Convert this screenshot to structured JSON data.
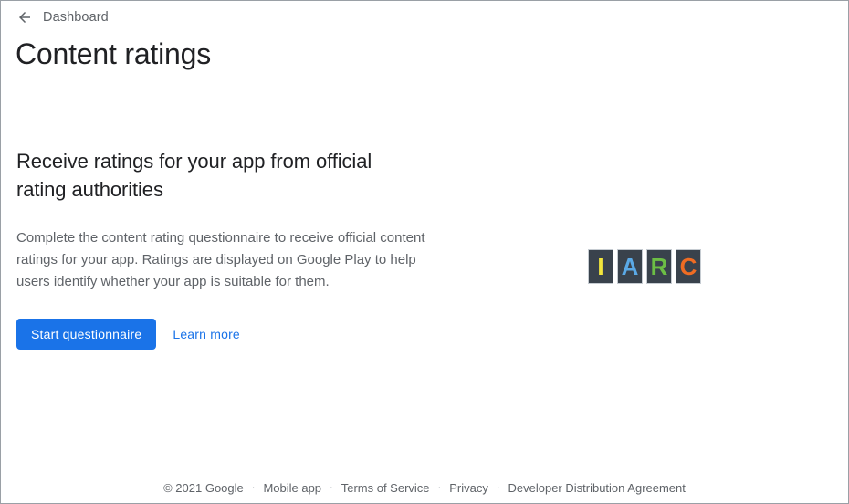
{
  "back_nav": {
    "icon": "arrow-left-icon",
    "label": "Dashboard"
  },
  "page_title": "Content ratings",
  "promo": {
    "heading": "Receive ratings for your app from official rating authorities",
    "body": "Complete the content rating questionnaire to receive official content ratings for your app. Ratings are displayed on Google Play to help users identify whether your app is suitable for them.",
    "primary_button": "Start questionnaire",
    "secondary_link": "Learn more"
  },
  "logo": {
    "name": "iarc-logo",
    "tiles": [
      {
        "letter": "I",
        "color": "#f2e63c"
      },
      {
        "letter": "A",
        "color": "#5aa9e6"
      },
      {
        "letter": "R",
        "color": "#6cbe45"
      },
      {
        "letter": "C",
        "color": "#ef6c23"
      }
    ],
    "tile_background": "#39424c",
    "tile_border": "#c6ccd2"
  },
  "footer": {
    "separator": "·",
    "items": [
      {
        "label": "© 2021 Google",
        "interactable": false
      },
      {
        "label": "Mobile app",
        "interactable": true
      },
      {
        "label": "Terms of Service",
        "interactable": true
      },
      {
        "label": "Privacy",
        "interactable": true
      },
      {
        "label": "Developer Distribution Agreement",
        "interactable": true
      }
    ]
  },
  "colors": {
    "accent": "#1a73e8",
    "text_primary": "#202124",
    "text_secondary": "#5f6368"
  }
}
